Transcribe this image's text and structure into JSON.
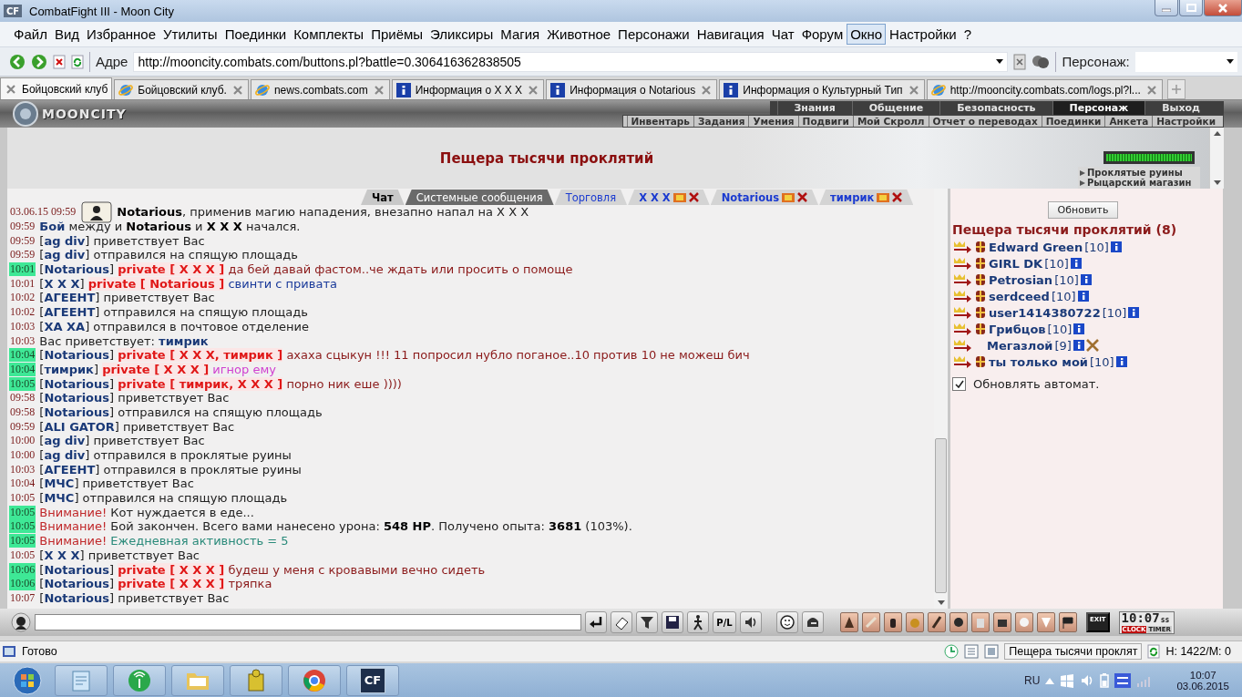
{
  "window": {
    "logo": "CF",
    "title": "CombatFight III - Moon City"
  },
  "menu": [
    {
      "label": "Файл",
      "selected": false
    },
    {
      "label": "Вид",
      "selected": false
    },
    {
      "label": "Избранное",
      "selected": false
    },
    {
      "label": "Утилиты",
      "selected": false
    },
    {
      "label": "Поединки",
      "selected": false
    },
    {
      "label": "Комплекты",
      "selected": false
    },
    {
      "label": "Приёмы",
      "selected": false
    },
    {
      "label": "Эликсиры",
      "selected": false
    },
    {
      "label": "Магия",
      "selected": false
    },
    {
      "label": "Животное",
      "selected": false
    },
    {
      "label": "Персонажи",
      "selected": false
    },
    {
      "label": "Навигация",
      "selected": false
    },
    {
      "label": "Чат",
      "selected": false
    },
    {
      "label": "Форум",
      "selected": false
    },
    {
      "label": "Окно",
      "selected": true
    },
    {
      "label": "Настройки",
      "selected": false
    },
    {
      "label": "?",
      "selected": false
    }
  ],
  "address": {
    "label": "Адре",
    "value": "http://mooncity.combats.com/buttons.pl?battle=0.306416362838505",
    "character_label": "Персонаж:"
  },
  "tabs": [
    {
      "label": "Бойцовский клуб",
      "kind": "plain",
      "selected": true
    },
    {
      "label": "Бойцовский клуб.",
      "kind": "web",
      "selected": false
    },
    {
      "label": "news.combats.com",
      "kind": "web",
      "selected": false
    },
    {
      "label": "Информация о X X X",
      "kind": "info",
      "selected": false
    },
    {
      "label": "Информация о Notarious",
      "kind": "info",
      "selected": false
    },
    {
      "label": "Информация о Культурный Тип",
      "kind": "info",
      "selected": false
    },
    {
      "label": "http://mooncity.combats.com/logs.pl?l...",
      "kind": "web",
      "selected": false
    }
  ],
  "game": {
    "logo": "MOONCITY",
    "nav": [
      {
        "label": "Знания",
        "selected": false
      },
      {
        "label": "Общение",
        "selected": false
      },
      {
        "label": "Безопасность",
        "selected": false
      },
      {
        "label": "Персонаж",
        "selected": true
      },
      {
        "label": "Выход",
        "selected": false
      }
    ],
    "subnav": [
      "Инвентарь",
      "Задания",
      "Умения",
      "Подвиги",
      "Мой Скролл",
      "Отчет о переводах",
      "Поединки",
      "Анкета",
      "Настройки"
    ],
    "location": "Пещера тысячи проклятий",
    "links": [
      "Проклятые руины",
      "Рыцарский магазин"
    ]
  },
  "chat_tabs": [
    {
      "label": "Чат",
      "kind": "main",
      "selected": true
    },
    {
      "label": "Системные сообщения",
      "kind": "system",
      "selected": false
    },
    {
      "label": "Торговля",
      "kind": "room",
      "selected": false
    },
    {
      "label": "X X X",
      "kind": "private",
      "selected": false
    },
    {
      "label": "Notarious",
      "kind": "private",
      "selected": false
    },
    {
      "label": "тимрик",
      "kind": "private",
      "selected": false
    }
  ],
  "chat": [
    {
      "time": "03.06.15 09:59",
      "new": false,
      "kind": "magic",
      "parts": [
        {
          "kind": "bold",
          "text": "Notarious"
        },
        {
          "kind": "plain",
          "text": ", применив магию нападения, внезапно напал на X X X"
        }
      ]
    },
    {
      "time": "09:59",
      "new": false,
      "kind": "text",
      "parts": [
        {
          "kind": "nick",
          "text": "Бой"
        },
        {
          "kind": "plain",
          "text": " между и "
        },
        {
          "kind": "bold",
          "text": "Notarious"
        },
        {
          "kind": "plain",
          "text": " и "
        },
        {
          "kind": "bold",
          "text": "X X X"
        },
        {
          "kind": "plain",
          "text": " начался."
        }
      ]
    },
    {
      "time": "09:59",
      "new": false,
      "kind": "text",
      "parts": [
        {
          "kind": "plain",
          "text": "["
        },
        {
          "kind": "nick",
          "text": "ag div"
        },
        {
          "kind": "plain",
          "text": "] приветствует Вас"
        }
      ]
    },
    {
      "time": "09:59",
      "new": false,
      "kind": "text",
      "parts": [
        {
          "kind": "plain",
          "text": "["
        },
        {
          "kind": "nick",
          "text": "ag div"
        },
        {
          "kind": "plain",
          "text": "] отправился на спящую площадь"
        }
      ]
    },
    {
      "time": "10:01",
      "new": true,
      "kind": "text",
      "parts": [
        {
          "kind": "plain",
          "text": "["
        },
        {
          "kind": "nick",
          "text": "Notarious"
        },
        {
          "kind": "plain",
          "text": "] "
        },
        {
          "kind": "private",
          "text": "private [ X X X ]"
        },
        {
          "kind": "red",
          "text": " да бей давай фастом..че ждать или просить о помоще"
        }
      ]
    },
    {
      "time": "10:01",
      "new": false,
      "kind": "text",
      "parts": [
        {
          "kind": "plain",
          "text": "["
        },
        {
          "kind": "nick",
          "text": "X X X"
        },
        {
          "kind": "plain",
          "text": "] "
        },
        {
          "kind": "private",
          "text": "private [ Notarious ]"
        },
        {
          "kind": "blue",
          "text": " свинти с привата"
        }
      ]
    },
    {
      "time": "10:02",
      "new": false,
      "kind": "text",
      "parts": [
        {
          "kind": "plain",
          "text": "["
        },
        {
          "kind": "nick",
          "text": "АГЕЕНТ"
        },
        {
          "kind": "plain",
          "text": "] приветствует Вас"
        }
      ]
    },
    {
      "time": "10:02",
      "new": false,
      "kind": "text",
      "parts": [
        {
          "kind": "plain",
          "text": "["
        },
        {
          "kind": "nick",
          "text": "АГЕЕНТ"
        },
        {
          "kind": "plain",
          "text": "] отправился на спящую площадь"
        }
      ]
    },
    {
      "time": "10:03",
      "new": false,
      "kind": "text",
      "parts": [
        {
          "kind": "plain",
          "text": "["
        },
        {
          "kind": "nick",
          "text": "ХА ХА"
        },
        {
          "kind": "plain",
          "text": "] отправился в почтовое отделение"
        }
      ]
    },
    {
      "time": "10:03",
      "new": false,
      "kind": "text",
      "parts": [
        {
          "kind": "plain",
          "text": "Вас приветствует: "
        },
        {
          "kind": "nick",
          "text": "тимрик"
        }
      ]
    },
    {
      "time": "10:04",
      "new": true,
      "kind": "text",
      "parts": [
        {
          "kind": "plain",
          "text": "["
        },
        {
          "kind": "nick",
          "text": "Notarious"
        },
        {
          "kind": "plain",
          "text": "] "
        },
        {
          "kind": "private",
          "text": "private [ X X X, тимрик ]"
        },
        {
          "kind": "red",
          "text": " ахаха сцыкун !!! 11 попросил нубло поганое..10 против 10 не можеш бич"
        }
      ]
    },
    {
      "time": "10:04",
      "new": true,
      "kind": "text",
      "parts": [
        {
          "kind": "plain",
          "text": "["
        },
        {
          "kind": "nick",
          "text": "тимрик"
        },
        {
          "kind": "plain",
          "text": "] "
        },
        {
          "kind": "private",
          "text": "private [ X X X ]"
        },
        {
          "kind": "pink",
          "text": " игнор ему"
        }
      ]
    },
    {
      "time": "10:05",
      "new": true,
      "kind": "text",
      "parts": [
        {
          "kind": "plain",
          "text": "["
        },
        {
          "kind": "nick",
          "text": "Notarious"
        },
        {
          "kind": "plain",
          "text": "] "
        },
        {
          "kind": "private",
          "text": "private [ тимрик, X X X ]"
        },
        {
          "kind": "red",
          "text": " порно ник еше ))))"
        }
      ]
    },
    {
      "time": "09:58",
      "new": false,
      "kind": "text",
      "parts": [
        {
          "kind": "plain",
          "text": "["
        },
        {
          "kind": "nick",
          "text": "Notarious"
        },
        {
          "kind": "plain",
          "text": "] приветствует Вас"
        }
      ]
    },
    {
      "time": "09:58",
      "new": false,
      "kind": "text",
      "parts": [
        {
          "kind": "plain",
          "text": "["
        },
        {
          "kind": "nick",
          "text": "Notarious"
        },
        {
          "kind": "plain",
          "text": "] отправился на спящую площадь"
        }
      ]
    },
    {
      "time": "09:59",
      "new": false,
      "kind": "text",
      "parts": [
        {
          "kind": "plain",
          "text": "["
        },
        {
          "kind": "nick",
          "text": "ALI GATOR"
        },
        {
          "kind": "plain",
          "text": "] приветствует Вас"
        }
      ]
    },
    {
      "time": "10:00",
      "new": false,
      "kind": "text",
      "parts": [
        {
          "kind": "plain",
          "text": "["
        },
        {
          "kind": "nick",
          "text": "ag div"
        },
        {
          "kind": "plain",
          "text": "] приветствует Вас"
        }
      ]
    },
    {
      "time": "10:00",
      "new": false,
      "kind": "text",
      "parts": [
        {
          "kind": "plain",
          "text": "["
        },
        {
          "kind": "nick",
          "text": "ag div"
        },
        {
          "kind": "plain",
          "text": "] отправился в проклятые руины"
        }
      ]
    },
    {
      "time": "10:03",
      "new": false,
      "kind": "text",
      "parts": [
        {
          "kind": "plain",
          "text": "["
        },
        {
          "kind": "nick",
          "text": "АГЕЕНТ"
        },
        {
          "kind": "plain",
          "text": "] отправился в проклятые руины"
        }
      ]
    },
    {
      "time": "10:04",
      "new": false,
      "kind": "text",
      "parts": [
        {
          "kind": "plain",
          "text": "["
        },
        {
          "kind": "nick",
          "text": "МЧС"
        },
        {
          "kind": "plain",
          "text": "] приветствует Вас"
        }
      ]
    },
    {
      "time": "10:05",
      "new": false,
      "kind": "text",
      "parts": [
        {
          "kind": "plain",
          "text": "["
        },
        {
          "kind": "nick",
          "text": "МЧС"
        },
        {
          "kind": "plain",
          "text": "] отправился на спящую площадь"
        }
      ]
    },
    {
      "time": "10:05",
      "new": true,
      "kind": "text",
      "parts": [
        {
          "kind": "alert",
          "text": "Внимание!"
        },
        {
          "kind": "plain",
          "text": " Кот нуждается в еде..."
        }
      ]
    },
    {
      "time": "10:05",
      "new": true,
      "kind": "text",
      "parts": [
        {
          "kind": "alert",
          "text": "Внимание!"
        },
        {
          "kind": "plain",
          "text": " Бой закончен. Всего вами нанесено урона: "
        },
        {
          "kind": "bold",
          "text": "548 HP"
        },
        {
          "kind": "plain",
          "text": ". Получено опыта: "
        },
        {
          "kind": "bold",
          "text": "3681"
        },
        {
          "kind": "plain",
          "text": " (103%)."
        }
      ]
    },
    {
      "time": "10:05",
      "new": true,
      "kind": "text",
      "parts": [
        {
          "kind": "alert",
          "text": "Внимание!"
        },
        {
          "kind": "green",
          "text": " Ежедневная активность = 5"
        }
      ]
    },
    {
      "time": "10:05",
      "new": false,
      "kind": "text",
      "parts": [
        {
          "kind": "plain",
          "text": "["
        },
        {
          "kind": "nick",
          "text": "X X X"
        },
        {
          "kind": "plain",
          "text": "] приветствует Вас"
        }
      ]
    },
    {
      "time": "10:06",
      "new": true,
      "kind": "text",
      "parts": [
        {
          "kind": "plain",
          "text": "["
        },
        {
          "kind": "nick",
          "text": "Notarious"
        },
        {
          "kind": "plain",
          "text": "] "
        },
        {
          "kind": "private",
          "text": "private [ X X X ]"
        },
        {
          "kind": "red",
          "text": " будеш у меня с кровавыми вечно сидеть"
        }
      ]
    },
    {
      "time": "10:06",
      "new": true,
      "kind": "text",
      "parts": [
        {
          "kind": "plain",
          "text": "["
        },
        {
          "kind": "nick",
          "text": "Notarious"
        },
        {
          "kind": "plain",
          "text": "] "
        },
        {
          "kind": "private",
          "text": "private [ X X X ]"
        },
        {
          "kind": "red",
          "text": " тряпка"
        }
      ]
    },
    {
      "time": "10:07",
      "new": false,
      "kind": "text",
      "parts": [
        {
          "kind": "plain",
          "text": "["
        },
        {
          "kind": "nick",
          "text": "Notarious"
        },
        {
          "kind": "plain",
          "text": "] приветствует Вас"
        }
      ]
    }
  ],
  "online": {
    "refresh": "Обновить",
    "title": "Пещера тысячи проклятий (8)",
    "users": [
      {
        "name": "Edward Green",
        "level": "[10]",
        "kind": "emblem"
      },
      {
        "name": "GIRL DK",
        "level": "[10]",
        "kind": "emblem"
      },
      {
        "name": "Petrosian",
        "level": "[10]",
        "kind": "emblem"
      },
      {
        "name": "serdceed",
        "level": "[10]",
        "kind": "emblem"
      },
      {
        "name": "user1414380722",
        "level": "[10]",
        "kind": "emblem"
      },
      {
        "name": "Грибцов",
        "level": "[10]",
        "kind": "emblem"
      },
      {
        "name": "Мегазлой",
        "level": "[9]",
        "kind": "crossed"
      },
      {
        "name": "ты только мой",
        "level": "[10]",
        "kind": "emblem"
      }
    ],
    "auto_refresh": {
      "label": "Обновлять автомат.",
      "checked": true
    }
  },
  "toolbar": {
    "pl": "P/L",
    "exit": "EXIT",
    "clock": "10:07",
    "clock_suffix": "ss",
    "clock_tab": "CLOCK",
    "timer_tab": "TIMER"
  },
  "status_bar": {
    "text": "Готово",
    "location": "Пещера тысячи проклят",
    "stats": "H: 1422/M: 0"
  },
  "taskbar": {
    "apps": [
      {
        "kind": "notepad"
      },
      {
        "kind": "radio"
      },
      {
        "kind": "folder"
      },
      {
        "kind": "game"
      },
      {
        "kind": "browser"
      },
      {
        "kind": "cf",
        "label": "CF"
      }
    ],
    "language": "RU",
    "time": "10:07",
    "date": "03.06.2015"
  }
}
